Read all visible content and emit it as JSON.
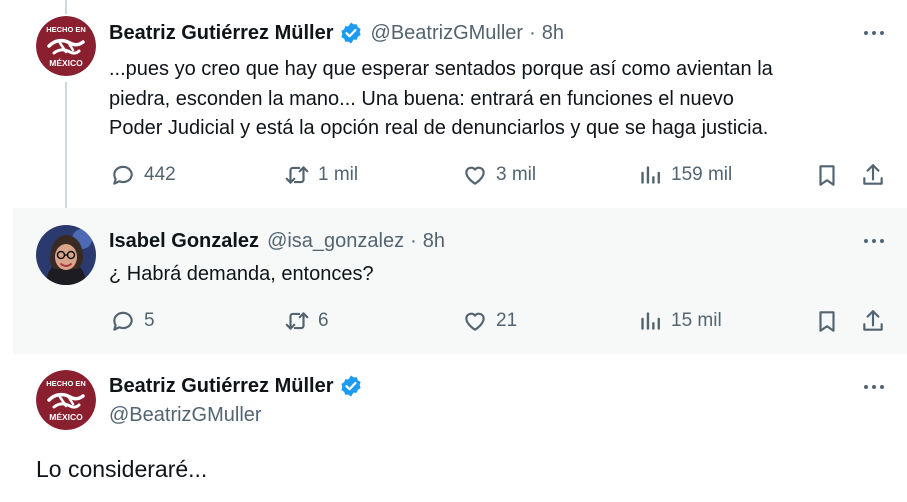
{
  "tweets": [
    {
      "author_name": "Beatriz Gutiérrez Müller",
      "handle": "@BeatrizGMuller",
      "separator": "·",
      "time": "8h",
      "avatar": {
        "logo_lines": [
          "HECHO EN",
          "MÉXICO"
        ]
      },
      "text_lines": [
        "...pues yo creo que hay que esperar sentados porque así como avientan la",
        "piedra, esconden la mano... Una buena: entrará en funciones el nuevo",
        "Poder Judicial y está la opción real de denunciarlos y que se haga justicia."
      ],
      "replies": "442",
      "reposts": "1 mil",
      "likes": "3 mil",
      "views": "159 mil"
    },
    {
      "author_name": "Isabel Gonzalez",
      "handle": "@isa_gonzalez",
      "separator": "·",
      "time": "8h",
      "text_lines": [
        "¿ Habrá demanda, entonces?"
      ],
      "replies": "5",
      "reposts": "6",
      "likes": "21",
      "views": "15 mil"
    },
    {
      "author_name": "Beatriz Gutiérrez Müller",
      "handle": "@BeatrizGMuller",
      "avatar": {
        "logo_lines": [
          "HECHO EN",
          "MÉXICO"
        ]
      },
      "text": "Lo consideraré..."
    }
  ],
  "colors": {
    "verified": "#1d9bf0",
    "logo": "#8a1f2f",
    "secondary_text": "#536471"
  },
  "icons": [
    "reply-icon",
    "repost-icon",
    "like-icon",
    "views-icon",
    "bookmark-icon",
    "share-icon",
    "more-icon",
    "verified-badge-icon"
  ]
}
